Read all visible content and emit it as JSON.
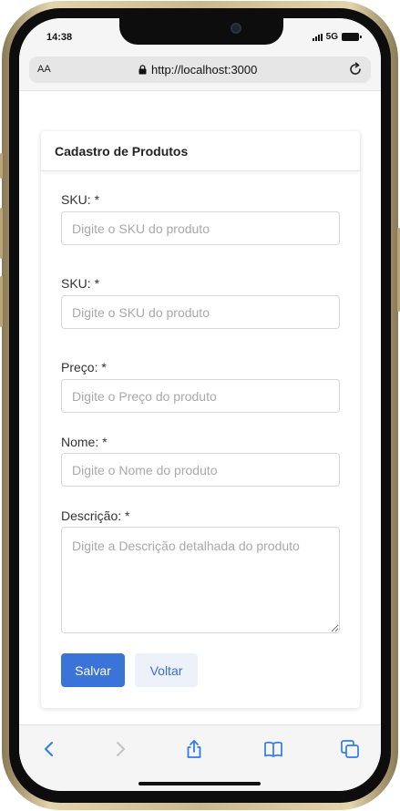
{
  "status": {
    "time": "14:38",
    "network": "5G"
  },
  "browser": {
    "text_size_label": "AA",
    "url": "http://localhost:3000"
  },
  "form": {
    "title": "Cadastro de Produtos",
    "fields": [
      {
        "label": "SKU: *",
        "placeholder": "Digite o SKU do produto"
      },
      {
        "label": "SKU: *",
        "placeholder": "Digite o SKU do produto"
      },
      {
        "label": "Preço: *",
        "placeholder": "Digite o Preço do produto"
      },
      {
        "label": "Nome: *",
        "placeholder": "Digite o Nome do produto"
      },
      {
        "label": "Descrição: *",
        "placeholder": "Digite a Descrição detalhada do produto"
      }
    ],
    "save_label": "Salvar",
    "back_label": "Voltar"
  },
  "colors": {
    "primary": "#3b74d9",
    "secondary_bg": "#ecf1fa",
    "toolbar_icon": "#2f7bf0"
  },
  "toolbar": {
    "icons": [
      "back-icon",
      "forward-icon",
      "share-icon",
      "bookmarks-icon",
      "tabs-icon"
    ]
  }
}
